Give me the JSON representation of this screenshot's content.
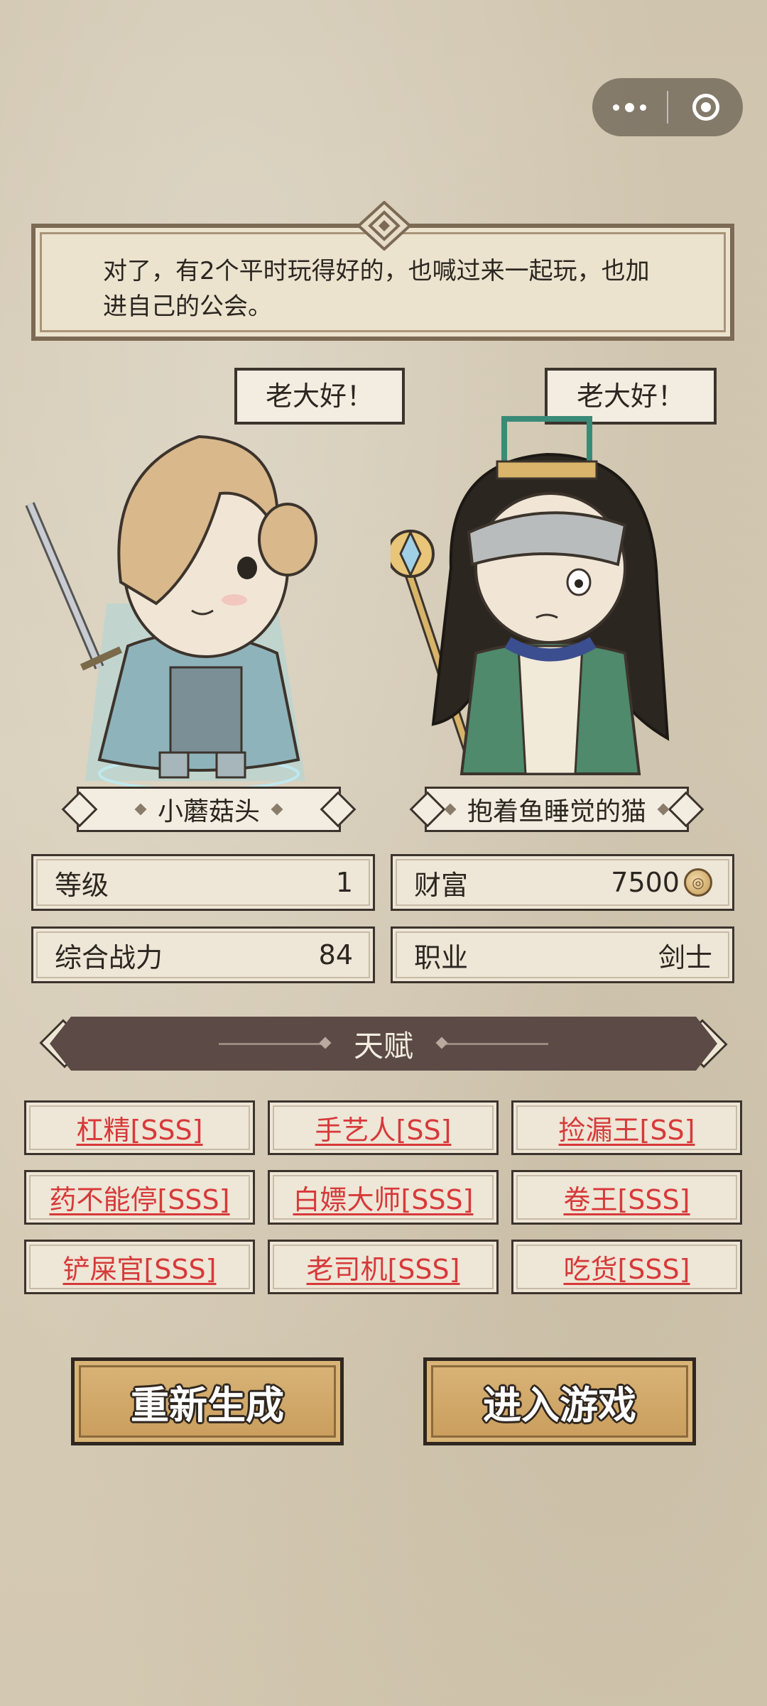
{
  "miniprogram_capsule": {
    "menu_icon": "more-dots-icon",
    "close_icon": "record-close-icon"
  },
  "dialog": {
    "text": "对了，有2个平时玩得好的，也喊过来一起玩，也加进自己的公会。"
  },
  "characters": [
    {
      "greeting": "老大好！",
      "name": "小蘑菇头"
    },
    {
      "greeting": "老大好！",
      "name": "抱着鱼睡觉的猫"
    }
  ],
  "stats": {
    "level_label": "等级",
    "level_value": "1",
    "wealth_label": "财富",
    "wealth_value": "7500",
    "power_label": "综合战力",
    "power_value": "84",
    "class_label": "职业",
    "class_value": "剑士"
  },
  "talents_section": {
    "title": "天赋"
  },
  "talents": [
    "杠精[SSS]",
    "手艺人[SS]",
    "捡漏王[SS]",
    "药不能停[SSS]",
    "白嫖大师[SSS]",
    "卷王[SSS]",
    "铲屎官[SSS]",
    "老司机[SSS]",
    "吃货[SSS]"
  ],
  "buttons": {
    "regenerate": "重新生成",
    "enter_game": "进入游戏"
  },
  "colors": {
    "talent_text": "#d7393a",
    "ribbon": "#5b4a45",
    "button": "#d2a866"
  }
}
